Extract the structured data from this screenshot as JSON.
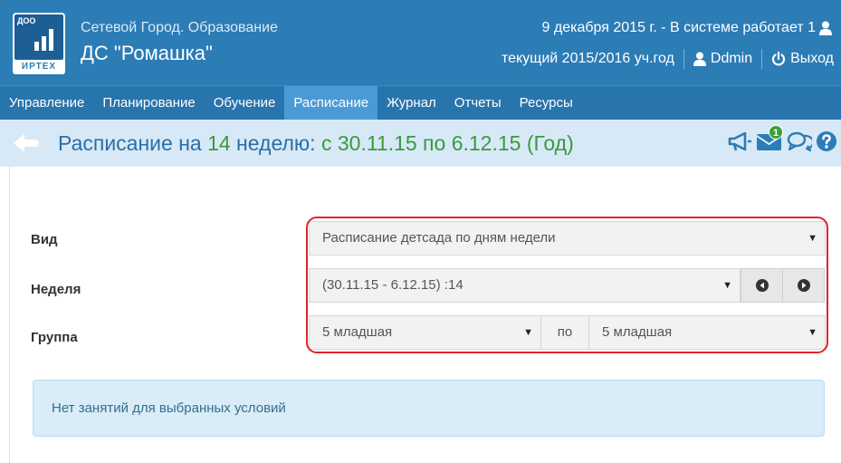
{
  "header": {
    "logo_badge": "ДОО",
    "logo_brand": "ИРТЕХ",
    "app_name": "Сетевой Город. Образование",
    "org_name": "ДС \"Ромашка\"",
    "date_text": "9 декабря 2015 г. - В системе работает 1",
    "year_text": "текущий 2015/2016 уч.год",
    "username": "Ddmin",
    "logout_label": "Выход",
    "user_icon": "user-icon",
    "logout_icon": "power-icon"
  },
  "nav": {
    "items": [
      {
        "label": "Управление"
      },
      {
        "label": "Планирование"
      },
      {
        "label": "Обучение"
      },
      {
        "label": "Расписание"
      },
      {
        "label": "Журнал"
      },
      {
        "label": "Отчеты"
      },
      {
        "label": "Ресурсы"
      }
    ],
    "active_index": 3
  },
  "titlebar": {
    "title_prefix": "Расписание на ",
    "week_number": "14",
    "title_middle": " неделю: ",
    "date_range": "с 30.11.15 по 6.12.15 (Год)",
    "back_icon": "back-arrow-icon",
    "icons": [
      "megaphone-icon",
      "mail-icon",
      "chat-icon",
      "help-icon"
    ],
    "mail_badge": "1"
  },
  "form": {
    "view_label": "Вид",
    "view_value": "Расписание детсада по дням недели",
    "week_label": "Неделя",
    "week_value": "(30.11.15 - 6.12.15) :14",
    "group_label": "Группа",
    "group_from": "5 младшая",
    "group_sep": "по",
    "group_to": "5 младшая"
  },
  "info": {
    "message": "Нет занятий для выбранных условий"
  },
  "colors": {
    "header_bg": "#2c7cb6",
    "nav_active": "#4a9bd5",
    "title_bg": "#d7e9f7",
    "accent_green": "#3a9a3a",
    "highlight_frame": "#e1232b"
  }
}
